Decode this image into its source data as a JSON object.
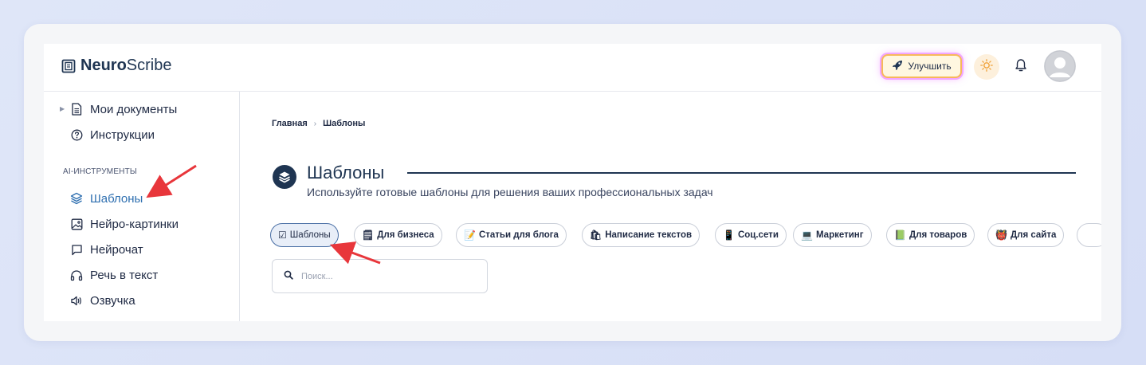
{
  "header": {
    "logo_bold": "Neuro",
    "logo_rest": "Scribe",
    "upgrade_label": "Улучшить"
  },
  "sidebar": {
    "items_top": [
      {
        "label": "Мои документы",
        "icon": "document-icon"
      },
      {
        "label": "Инструкции",
        "icon": "help-circle-icon"
      }
    ],
    "section_title": "AI-ИНСТРУМЕНТЫ",
    "items_tools": [
      {
        "label": "Шаблоны",
        "icon": "layers-icon",
        "active": true
      },
      {
        "label": "Нейро-картинки",
        "icon": "image-icon"
      },
      {
        "label": "Нейрочат",
        "icon": "chat-icon"
      },
      {
        "label": "Речь в текст",
        "icon": "headphones-icon"
      },
      {
        "label": "Озвучка",
        "icon": "speaker-icon"
      }
    ]
  },
  "breadcrumb": {
    "home": "Главная",
    "sep": "›",
    "current": "Шаблоны"
  },
  "page": {
    "title": "Шаблоны",
    "subtitle": "Используйте готовые шаблоны для решения ваших профессиональных задач"
  },
  "chips": [
    {
      "emoji": "☑",
      "label": "Шаблоны",
      "active": true
    },
    {
      "emoji": "🗒",
      "label": "Для бизнеса"
    },
    {
      "emoji": "📝",
      "label": "Статьи для блога"
    },
    {
      "emoji": "🛍",
      "label": "Написание текстов"
    },
    {
      "emoji": "📱",
      "label": "Соц.сети"
    },
    {
      "emoji": "💻",
      "label": "Маркетинг"
    },
    {
      "emoji": "📗",
      "label": "Для товаров"
    },
    {
      "emoji": "👹",
      "label": "Для сайта"
    }
  ],
  "search": {
    "placeholder": "Поиск..."
  },
  "colors": {
    "accent": "#2e6fb0",
    "navy": "#1f3552",
    "annotation_arrow": "#e8363b"
  }
}
